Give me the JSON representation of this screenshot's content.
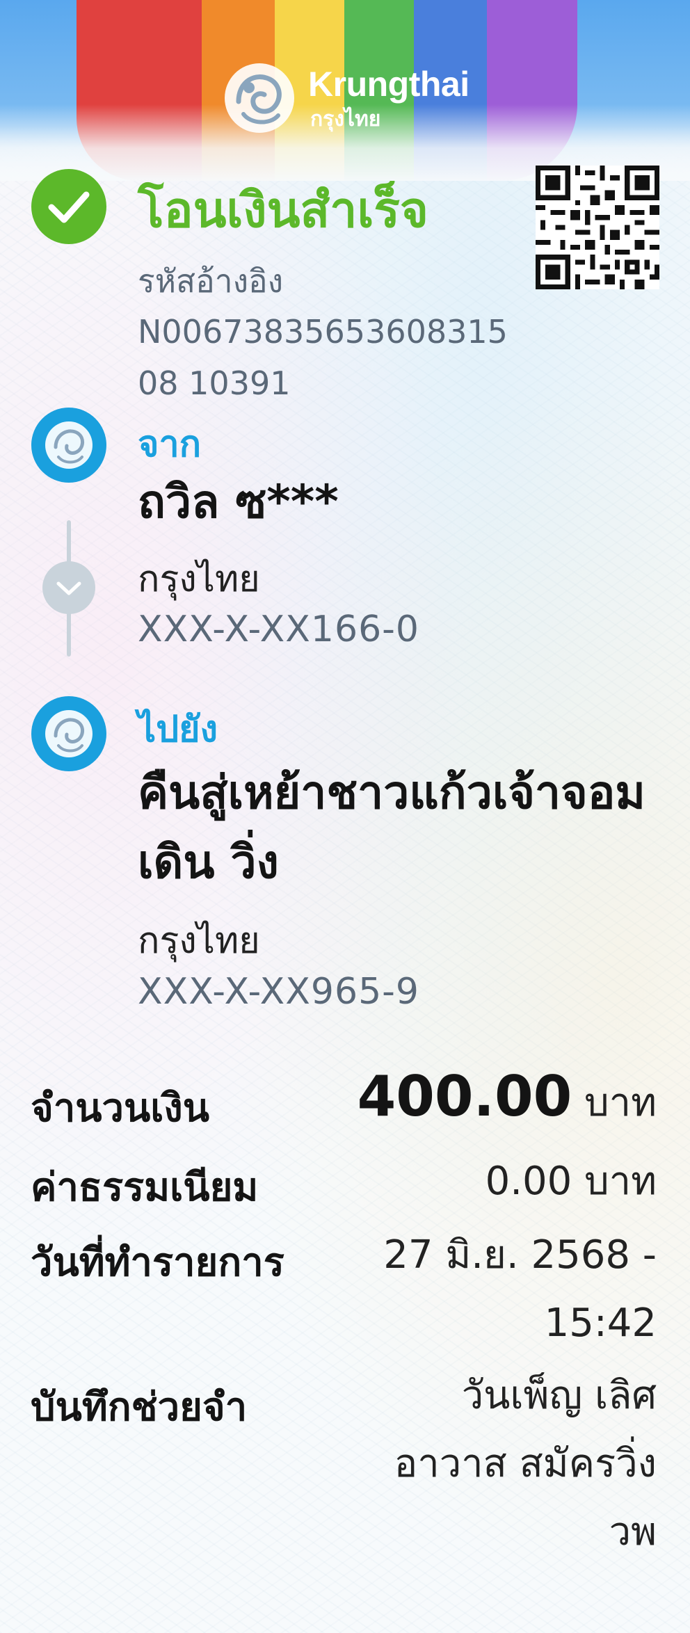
{
  "header": {
    "brand_en": "Krungthai",
    "brand_th": "กรุงไทย"
  },
  "status": {
    "title": "โอนเงินสำเร็จ",
    "icon": "check-circle-icon",
    "color": "#5cb82a"
  },
  "reference": {
    "label": "รหัสอ้างอิง",
    "code": "N0067383565360831508 10391"
  },
  "from": {
    "label": "จาก",
    "name": "ถวิล ซ***",
    "bank": "กรุงไทย",
    "account": "XXX-X-XX166-0"
  },
  "to": {
    "label": "ไปยัง",
    "name": "คืนสู่เหย้าชาวแก้วเจ้าจอม เดิน วิ่ง",
    "bank": "กรุงไทย",
    "account": "XXX-X-XX965-9"
  },
  "details": {
    "amount_label": "จำนวนเงิน",
    "amount_value": "400.00",
    "amount_unit": "บาท",
    "fee_label": "ค่าธรรมเนียม",
    "fee_value": "0.00 บาท",
    "date_label": "วันที่ทำรายการ",
    "date_value": "27 มิ.ย. 2568 - 15:42",
    "memo_label": "บันทึกช่วยจำ",
    "memo_value": "วันเพ็ญ เลิศอาวาส สมัครวิ่ง วพ"
  },
  "colors": {
    "accent_blue": "#1aa0de",
    "success_green": "#5cb82a"
  }
}
